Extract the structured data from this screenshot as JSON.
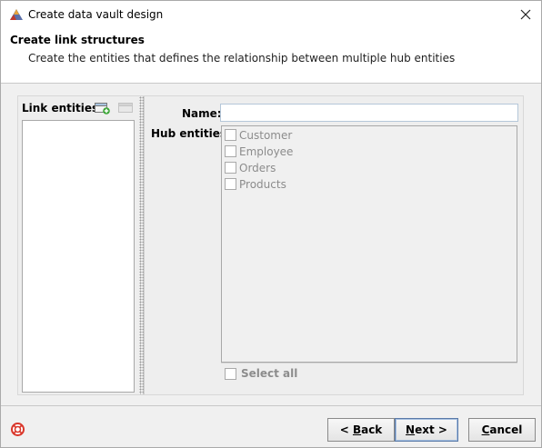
{
  "window": {
    "title": "Create data vault design",
    "close_glyph": "✕"
  },
  "header": {
    "title": "Create link structures",
    "subtitle": "Create the entities that defines the relationship between multiple hub entities"
  },
  "link_panel": {
    "label": "Link entities:",
    "add_icon": "add-entity-icon",
    "remove_icon": "remove-entity-icon",
    "items": []
  },
  "form": {
    "name_label": "Name:",
    "name_value": "",
    "hub_label": "Hub entities:",
    "hubs": [
      {
        "label": "Customer",
        "checked": false
      },
      {
        "label": "Employee",
        "checked": false
      },
      {
        "label": "Orders",
        "checked": false
      },
      {
        "label": "Products",
        "checked": false
      }
    ],
    "select_all_label": "Select all"
  },
  "footer": {
    "back_prefix": "< ",
    "back_mnemonic": "B",
    "back_rest": "ack",
    "next_mnemonic": "N",
    "next_rest": "ext >",
    "cancel_mnemonic": "C",
    "cancel_rest": "ancel"
  },
  "colors": {
    "disabled_text": "#8c8c8c",
    "dialog_bg": "#f0f0f0",
    "default_button_border": "#5a7aa8"
  }
}
